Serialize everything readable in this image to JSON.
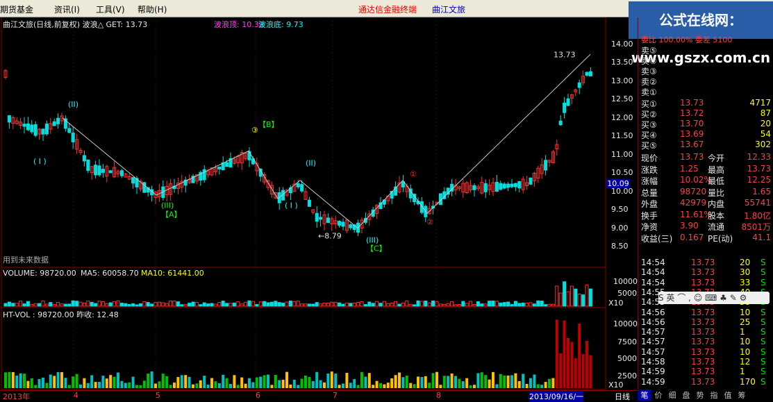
{
  "menu": {
    "items": [
      "期货基金",
      "资讯(I)",
      "工具(V)",
      "帮助(H)"
    ],
    "brand": "通达信金融终端",
    "stock_name": "曲江文旅"
  },
  "watermark": "公式在线网：www.gszx.com.cn",
  "main_chart": {
    "title": "曲江文旅(日线,前复权) 波浪△ GET: 13.73",
    "wave_top": "波浪顶: 10.39",
    "wave_bottom": "波浪底: 9.73",
    "note": "用到未来数据",
    "price_ticks": [
      "14.00",
      "13.50",
      "13.00",
      "12.50",
      "12.00",
      "11.50",
      "11.00",
      "10.50",
      "10.00",
      "9.50",
      "9.00",
      "8.50"
    ],
    "current_price_box": "10.09",
    "high_label": "13.73",
    "low_label": "8.79",
    "wave_labels": [
      {
        "text": "( I )"
      },
      {
        "text": "(II)"
      },
      {
        "text": "(III)"
      },
      {
        "text": "【A】"
      },
      {
        "text": "③"
      },
      {
        "text": "【B】"
      },
      {
        "text": "(II)"
      },
      {
        "text": "( I )"
      },
      {
        "text": "(III)"
      },
      {
        "text": "【C】"
      },
      {
        "text": "①"
      },
      {
        "text": "②"
      }
    ],
    "colors": {
      "up": "#ff3030",
      "down": "#00e0e0",
      "grid": "#8b0000"
    }
  },
  "volume_panel": {
    "title_vol": "VOLUME: 98720.00",
    "title_ma5": "MA5: 60058.70",
    "title_ma10": "MA10: 61441.00",
    "ticks": [
      "10000",
      "5000"
    ],
    "unit": "X10"
  },
  "htvol_panel": {
    "title": "HT-VOL : 98720.00 昨收: 12.48",
    "ticks": [
      "10000",
      "7500",
      "5000",
      "2500"
    ],
    "unit": "X10"
  },
  "x_axis": {
    "labels": [
      "2013年",
      "4",
      "5",
      "6",
      "7",
      "8"
    ],
    "cursor_date": "2013/09/16/一",
    "period": "日线"
  },
  "quote": {
    "webi": "委比 100.00%  委差 5100",
    "sell_levels": [
      "卖⑤",
      "卖④",
      "卖③",
      "卖②",
      "卖①"
    ],
    "buy_levels": [
      {
        "label": "买①",
        "price": "13.73",
        "vol": "4717"
      },
      {
        "label": "买②",
        "price": "13.72",
        "vol": "87"
      },
      {
        "label": "买③",
        "price": "13.70",
        "vol": "20"
      },
      {
        "label": "买④",
        "price": "13.69",
        "vol": "54"
      },
      {
        "label": "买⑤",
        "price": "13.67",
        "vol": "302"
      }
    ],
    "stats": [
      {
        "l1": "现价",
        "v1": "13.73",
        "l2": "今开",
        "v2": "12.33"
      },
      {
        "l1": "涨跌",
        "v1": "1.25",
        "l2": "最高",
        "v2": "13.73"
      },
      {
        "l1": "涨幅",
        "v1": "10.02%",
        "l2": "最低",
        "v2": "12.25"
      },
      {
        "l1": "总量",
        "v1": "98720",
        "l2": "量比",
        "v2": "1.65"
      },
      {
        "l1": "外盘",
        "v1": "42979",
        "l2": "内盘",
        "v2": "55741"
      },
      {
        "l1": "换手",
        "v1": "11.61%",
        "l2": "股本",
        "v2": "1.80亿"
      },
      {
        "l1": "净资",
        "v1": "3.90",
        "l2": "流通",
        "v2": "8501万"
      },
      {
        "l1": "收益(三)",
        "v1": "0.167",
        "l2": "PE(动)",
        "v2": "41.1"
      }
    ],
    "ticks": [
      {
        "t": "14:54",
        "p": "13.73",
        "v": "20",
        "s": "S"
      },
      {
        "t": "14:54",
        "p": "13.73",
        "v": "30",
        "s": "S"
      },
      {
        "t": "14:54",
        "p": "13.73",
        "v": "33",
        "s": "S"
      },
      {
        "t": "14:55",
        "p": "13.73",
        "v": "40",
        "s": "S"
      },
      {
        "t": "14:55",
        "p": "13.73",
        "v": "38",
        "s": "S"
      },
      {
        "t": "14:56",
        "p": "13.73",
        "v": "10",
        "s": "S"
      },
      {
        "t": "14:56",
        "p": "13.73",
        "v": "25",
        "s": "S"
      },
      {
        "t": "14:57",
        "p": "13.73",
        "v": "1",
        "s": "S"
      },
      {
        "t": "14:57",
        "p": "13.73",
        "v": "10",
        "s": "S"
      },
      {
        "t": "14:57",
        "p": "13.73",
        "v": "10",
        "s": "S"
      },
      {
        "t": "14:58",
        "p": "13.73",
        "v": "12",
        "s": "S"
      },
      {
        "t": "14:59",
        "p": "13.73",
        "v": "1",
        "s": "S"
      },
      {
        "t": "14:59",
        "p": "13.73",
        "v": "170",
        "s": "S"
      }
    ],
    "tabs": [
      "笔",
      "价",
      "细",
      "盘",
      "势",
      "指",
      "值",
      "筹"
    ]
  },
  "ime": "S 英 ⌒ , ☺ ⌨ ♣ ✎ ⚙"
}
